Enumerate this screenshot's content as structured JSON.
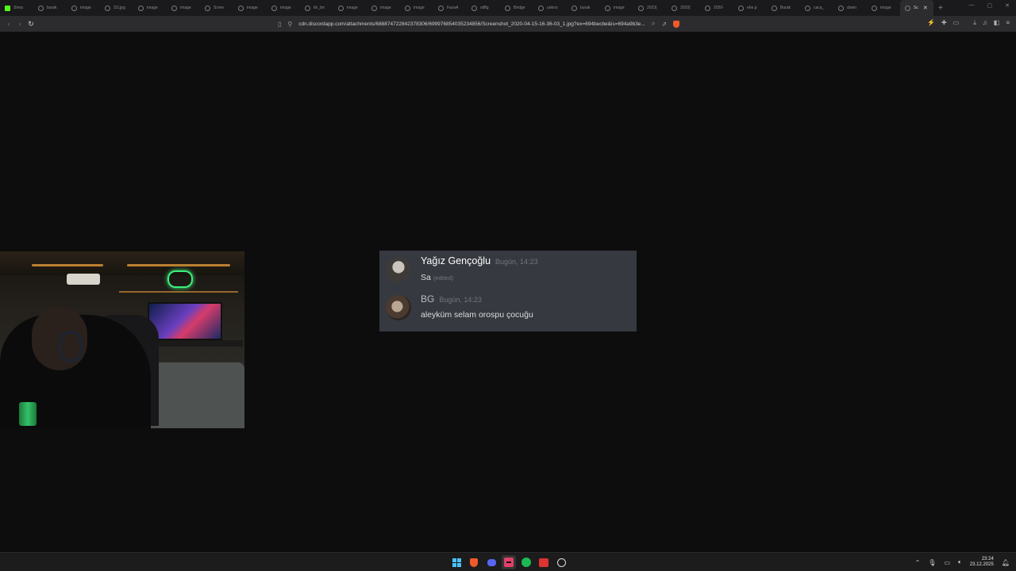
{
  "browser": {
    "tabs": [
      {
        "title": "Strea",
        "favicon": "kick-icon"
      },
      {
        "title": "burak"
      },
      {
        "title": "image"
      },
      {
        "title": "SS.jpg"
      },
      {
        "title": "image"
      },
      {
        "title": "image"
      },
      {
        "title": "Scree"
      },
      {
        "title": "image"
      },
      {
        "title": "image"
      },
      {
        "title": "kh_bri"
      },
      {
        "title": "image"
      },
      {
        "title": "image"
      },
      {
        "title": "image"
      },
      {
        "title": "FaceA"
      },
      {
        "title": "stiffg"
      },
      {
        "title": "Bridge"
      },
      {
        "title": "unkno"
      },
      {
        "title": "burak"
      },
      {
        "title": "image"
      },
      {
        "title": "2023("
      },
      {
        "title": "2020("
      },
      {
        "title": "2020-"
      },
      {
        "title": "ehe.p"
      },
      {
        "title": "Burak"
      },
      {
        "title": "caca_"
      },
      {
        "title": "down"
      },
      {
        "title": "image"
      },
      {
        "title": "Sc",
        "active": true
      }
    ],
    "url": "cdn.discordapp.com/attachments/688874722842378306/699976854035234856/Screenshot_2020-04-15-16-36-03_1.jpg?ex=694becbe&is=694a9b3e..."
  },
  "discord": {
    "messages": [
      {
        "author": "Yağız Gençoğlu",
        "timestamp": "Bugün, 14:23",
        "text": "Sa",
        "edited": "(edited)"
      },
      {
        "author": "BG",
        "timestamp": "Bugün, 14:23",
        "text": "aleyküm selam orospu çocuğu"
      }
    ]
  },
  "taskbar": {
    "apps": [
      "windows-start-icon",
      "brave-icon",
      "discord-icon",
      "kick-icon",
      "spotify-icon",
      "media-icon",
      "obs-icon"
    ],
    "clock_time": "23:24",
    "clock_date": "23.12.2025"
  }
}
